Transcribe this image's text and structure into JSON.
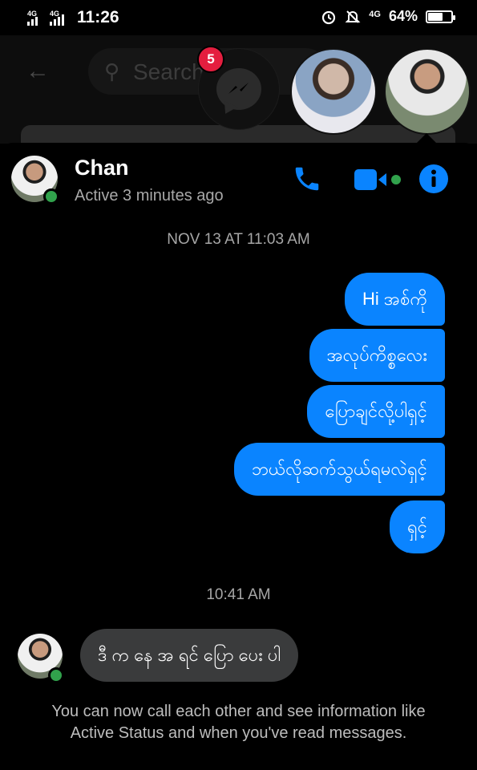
{
  "status_bar": {
    "network_1": "4G",
    "network_2": "4G",
    "time": "11:26",
    "data_type": "4G",
    "battery_percent": "64%",
    "battery_level": 0.64
  },
  "background_app": {
    "search_placeholder": "Search"
  },
  "chat_heads": {
    "unread_count": "5"
  },
  "chat": {
    "contact_name": "Chan",
    "active_status": "Active 3 minutes ago",
    "accent_color": "#0a84ff",
    "online_color": "#31a24c"
  },
  "messages": {
    "timestamp_1": "NOV 13 AT 11:03 AM",
    "outgoing": [
      "Hi အစ်ကို",
      "အလုပ်ကိစ္စလေး",
      "ပြောချင်လို့ပါရှင့်",
      "ဘယ်လိုဆက်သွယ်ရမလဲရှင့်",
      "ရှင့်"
    ],
    "timestamp_2": "10:41 AM",
    "incoming": "ဒီ က နေ အ ရင် ပြော ပေး ပါ",
    "footer_note": "You can now call each other and see information like Active Status and when you've read messages."
  }
}
